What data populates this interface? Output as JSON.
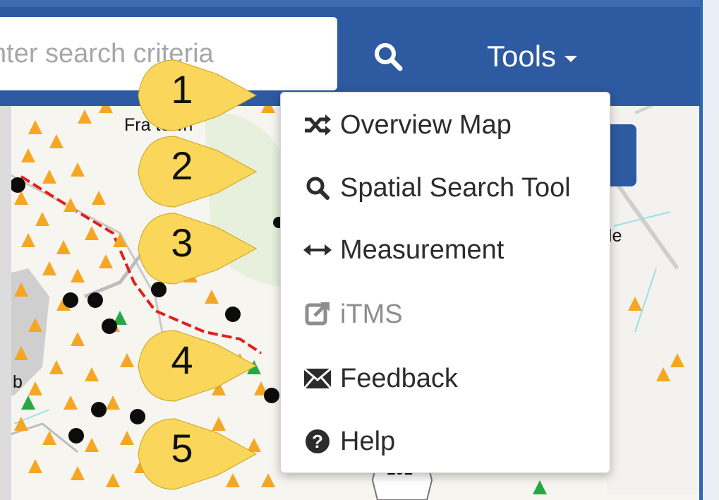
{
  "search": {
    "placeholder": "nter search criteria"
  },
  "toolbar": {
    "tools_label": "Tools"
  },
  "map": {
    "labels": {
      "town": "Fra    town",
      "partial_right": "le",
      "partial_left": "b",
      "route_badge": "101"
    }
  },
  "tools_menu": {
    "items": [
      {
        "label": "Overview Map",
        "icon": "shuffle-icon",
        "enabled": true
      },
      {
        "label": "Spatial Search Tool",
        "icon": "search-icon",
        "enabled": true
      },
      {
        "label": "Measurement",
        "icon": "horizontal-arrows-icon",
        "enabled": true
      },
      {
        "label": "iTMS",
        "icon": "external-link-icon",
        "enabled": false
      },
      {
        "label": "Feedback",
        "icon": "envelope-icon",
        "enabled": true
      },
      {
        "label": "Help",
        "icon": "question-circle-icon",
        "enabled": true
      }
    ]
  },
  "callouts": [
    "1",
    "2",
    "3",
    "4",
    "5"
  ],
  "colors": {
    "navbar": "#2d5aa1",
    "callout_fill": "#fad65a",
    "marker_orange": "#f5a623",
    "route_red": "#e0201b",
    "disabled_text": "#8d8d8d"
  }
}
